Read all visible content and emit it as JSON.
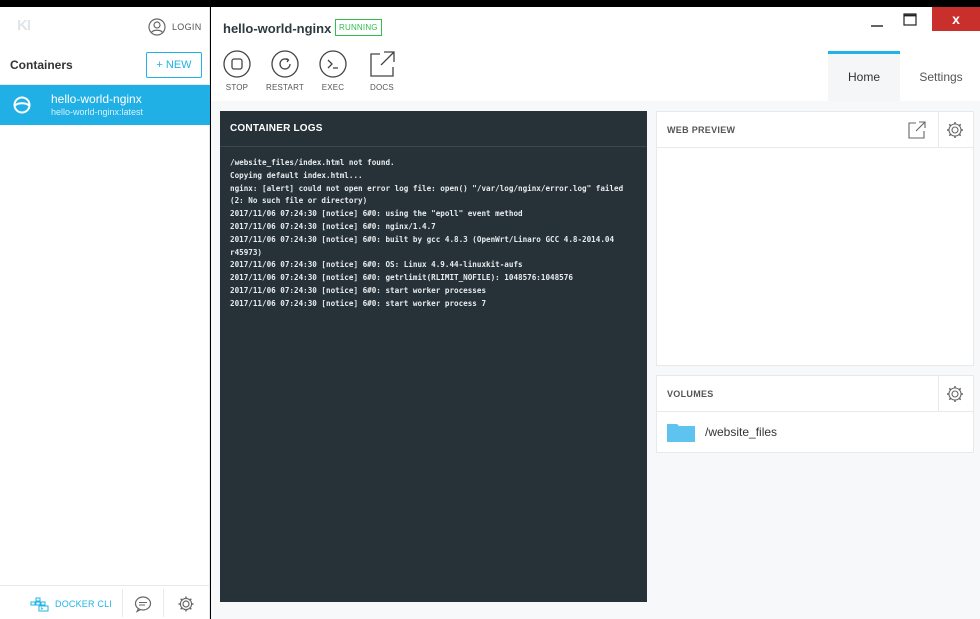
{
  "sidebar": {
    "logo": "KI",
    "login_label": "LOGIN",
    "section_title": "Containers",
    "new_button": "+ NEW",
    "containers": [
      {
        "name": "hello-world-nginx",
        "image": "hello-world-nginx:latest",
        "selected": true
      }
    ],
    "footer": {
      "docker_cli_label": "DOCKER CLI"
    }
  },
  "header": {
    "container_name": "hello-world-nginx",
    "status": "RUNNING",
    "window_close": "x"
  },
  "toolbar": {
    "stop": "STOP",
    "restart": "RESTART",
    "exec": "EXEC",
    "docs": "DOCS"
  },
  "tabs": {
    "home": "Home",
    "settings": "Settings",
    "active": "Home"
  },
  "logs": {
    "title": "CONTAINER LOGS",
    "lines": [
      "/website_files/index.html not found.",
      "Copying default index.html...",
      "nginx: [alert] could not open error log file: open() \"/var/log/nginx/error.log\" failed (2: No such file or directory)",
      "2017/11/06 07:24:30 [notice] 6#0: using the \"epoll\" event method",
      "2017/11/06 07:24:30 [notice] 6#0: nginx/1.4.7",
      "2017/11/06 07:24:30 [notice] 6#0: built by gcc 4.8.3 (OpenWrt/Linaro GCC 4.8-2014.04 r45973)",
      "2017/11/06 07:24:30 [notice] 6#0: OS: Linux 4.9.44-linuxkit-aufs",
      "2017/11/06 07:24:30 [notice] 6#0: getrlimit(RLIMIT_NOFILE): 1048576:1048576",
      "2017/11/06 07:24:30 [notice] 6#0: start worker processes",
      "2017/11/06 07:24:30 [notice] 6#0: start worker process 7"
    ]
  },
  "web_preview": {
    "title": "WEB PREVIEW"
  },
  "volumes": {
    "title": "VOLUMES",
    "items": [
      {
        "path": "/website_files"
      }
    ]
  },
  "colors": {
    "accent": "#20b3e7",
    "running": "#2fbe4d",
    "log_bg": "#263238",
    "close": "#c9302c"
  }
}
